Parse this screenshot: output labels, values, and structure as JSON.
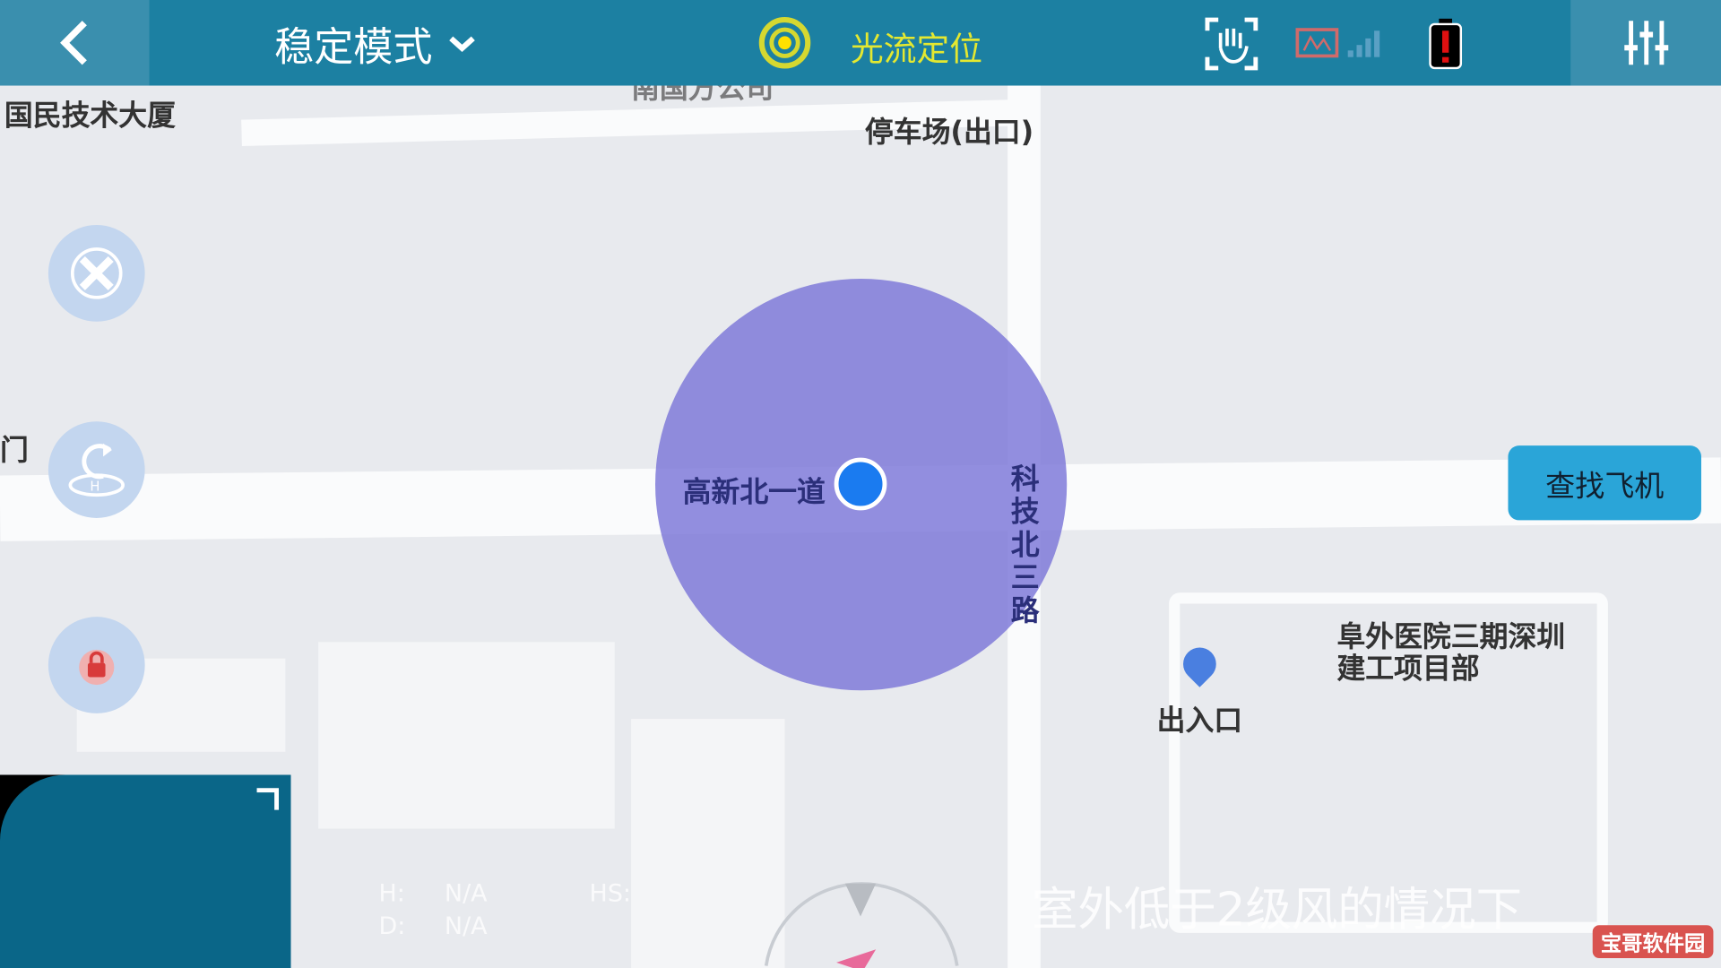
{
  "header": {
    "mode_label": "稳定模式",
    "positioning_label": "光流定位",
    "icons": [
      "back-icon",
      "chevron-down-icon",
      "optical-flow-icon",
      "gesture-hand-icon",
      "image-transmission-icon",
      "signal-icon",
      "battery-warning-icon",
      "settings-sliders-icon"
    ]
  },
  "map": {
    "labels": {
      "building": "国民技术大厦",
      "parking": "停车场(出口)",
      "road_h": "高新北一道",
      "road_v": "科技北三路",
      "entrance": "出入口",
      "site": "阜外医院三期深圳建工项目部",
      "partial_top": "南国方公司",
      "partial_left": "门"
    },
    "accuracy_color": "#7873d7",
    "dot_color": "#1a7bf0"
  },
  "side_buttons": [
    "takeoff-land-icon",
    "return-home-icon",
    "lock-icon"
  ],
  "find_aircraft_label": "查找飞机",
  "telemetry": {
    "h_label": "H:",
    "h_value": "N/A",
    "d_label": "D:",
    "d_value": "N/A",
    "hs_label": "HS:"
  },
  "subtitle": "室外低于2级风的情况下",
  "watermark": "宝哥软件园"
}
